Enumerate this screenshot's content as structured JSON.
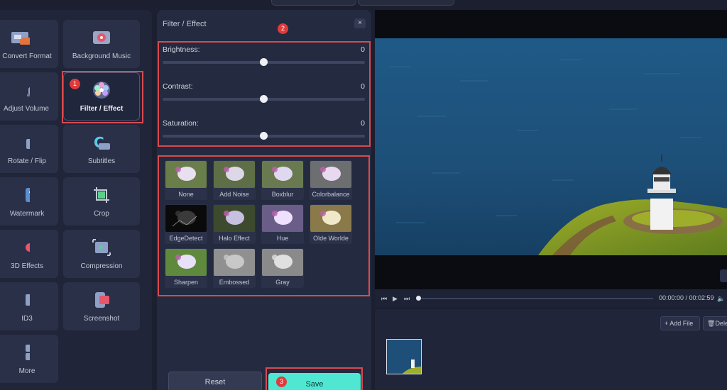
{
  "tools": [
    {
      "label": "Convert Format",
      "icon": "convert-format-icon"
    },
    {
      "label": "Background Music",
      "icon": "background-music-icon"
    },
    {
      "label": "Adjust Volume",
      "icon": "adjust-volume-icon"
    },
    {
      "label": "Filter / Effect",
      "icon": "filter-effect-icon",
      "active": true
    },
    {
      "label": "Rotate / Flip",
      "icon": "rotate-flip-icon"
    },
    {
      "label": "Subtitles",
      "icon": "subtitles-icon"
    },
    {
      "label": "Watermark",
      "icon": "watermark-icon"
    },
    {
      "label": "Crop",
      "icon": "crop-icon"
    },
    {
      "label": "3D Effects",
      "icon": "3d-effects-icon"
    },
    {
      "label": "Compression",
      "icon": "compression-icon"
    },
    {
      "label": "ID3",
      "icon": "id3-icon"
    },
    {
      "label": "Screenshot",
      "icon": "screenshot-icon"
    },
    {
      "label": "More",
      "icon": "more-icon"
    }
  ],
  "badges": {
    "one": "1",
    "two": "2",
    "three": "3"
  },
  "panel": {
    "title": "Filter / Effect",
    "close": "×",
    "adjustments": [
      {
        "label": "Brightness:",
        "value": "0",
        "level": 0.5
      },
      {
        "label": "Contrast:",
        "value": "0",
        "level": 0.5
      },
      {
        "label": "Saturation:",
        "value": "0",
        "level": 0.5
      }
    ],
    "effects": [
      "None",
      "Add Noise",
      "Boxblur",
      "Colorbalance",
      "EdgeDetect",
      "Halo Effect",
      "Hue",
      "Olde Worlde",
      "Sharpen",
      "Embossed",
      "Gray"
    ],
    "reset_label": "Reset",
    "save_label": "Save"
  },
  "player": {
    "time": "00:00:00 / 00:02:59",
    "progress": 0
  },
  "files": {
    "add_label": "+ Add File",
    "delete_label": "Delete"
  },
  "colors": {
    "accent": "#4fe7d2",
    "highlight": "#d84a4f",
    "badge": "#e03a3a"
  }
}
